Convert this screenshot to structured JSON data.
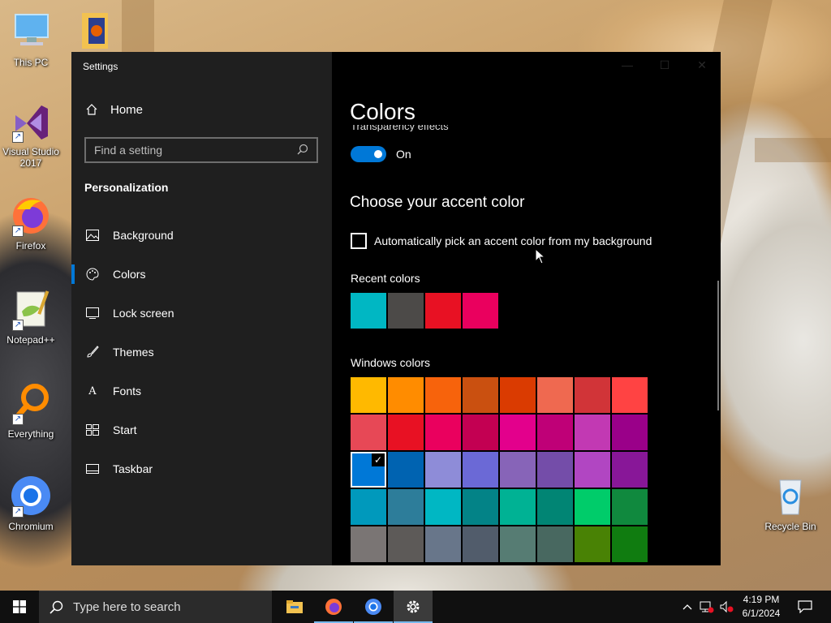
{
  "desktop": {
    "icons": [
      {
        "label": "This PC"
      },
      {
        "label": "Visual Studio 2017"
      },
      {
        "label": "Firefox"
      },
      {
        "label": "Notepad++"
      },
      {
        "label": "Everything"
      },
      {
        "label": "Chromium"
      },
      {
        "label": "Recycle Bin"
      }
    ]
  },
  "window": {
    "title": "Settings",
    "controls": {
      "minimize": "—",
      "maximize": "☐",
      "close": "✕"
    }
  },
  "sidebar": {
    "home_label": "Home",
    "search_placeholder": "Find a setting",
    "section_title": "Personalization",
    "items": [
      {
        "label": "Background",
        "icon": "picture-icon"
      },
      {
        "label": "Colors",
        "icon": "palette-icon",
        "selected": true
      },
      {
        "label": "Lock screen",
        "icon": "lock-screen-icon"
      },
      {
        "label": "Themes",
        "icon": "brush-icon"
      },
      {
        "label": "Fonts",
        "icon": "font-icon"
      },
      {
        "label": "Start",
        "icon": "start-grid-icon"
      },
      {
        "label": "Taskbar",
        "icon": "taskbar-icon"
      }
    ]
  },
  "main": {
    "title": "Colors",
    "transparency_label": "Transparency effects",
    "transparency_state": "On",
    "accent_heading": "Choose your accent color",
    "auto_pick_label": "Automatically pick an accent color from my background",
    "auto_pick_checked": false,
    "recent_label": "Recent colors",
    "recent_colors": [
      "#00b7c3",
      "#4c4a48",
      "#e81123",
      "#ea005e"
    ],
    "windows_label": "Windows colors",
    "windows_colors": [
      "#ffb900",
      "#ff8c00",
      "#f7630c",
      "#ca5010",
      "#da3b01",
      "#ef6950",
      "#d13438",
      "#ff4343",
      "#e74856",
      "#e81123",
      "#ea005e",
      "#c30052",
      "#e3008c",
      "#bf0077",
      "#c239b3",
      "#9a0089",
      "#0078d7",
      "#0063b1",
      "#8e8cd8",
      "#6b69d6",
      "#8764b8",
      "#744da9",
      "#b146c2",
      "#881798",
      "#0099bc",
      "#2d7d9a",
      "#00b7c3",
      "#038387",
      "#00b294",
      "#018574",
      "#00cc6a",
      "#10893e",
      "#7a7574",
      "#5d5a58",
      "#68768a",
      "#515c6b",
      "#567c73",
      "#486860",
      "#498205",
      "#107c10"
    ],
    "selected_color_index": 16,
    "accent_color": "#0078d7"
  },
  "taskbar": {
    "search_placeholder": "Type here to search",
    "time": "4:19 PM",
    "date": "6/1/2024"
  }
}
